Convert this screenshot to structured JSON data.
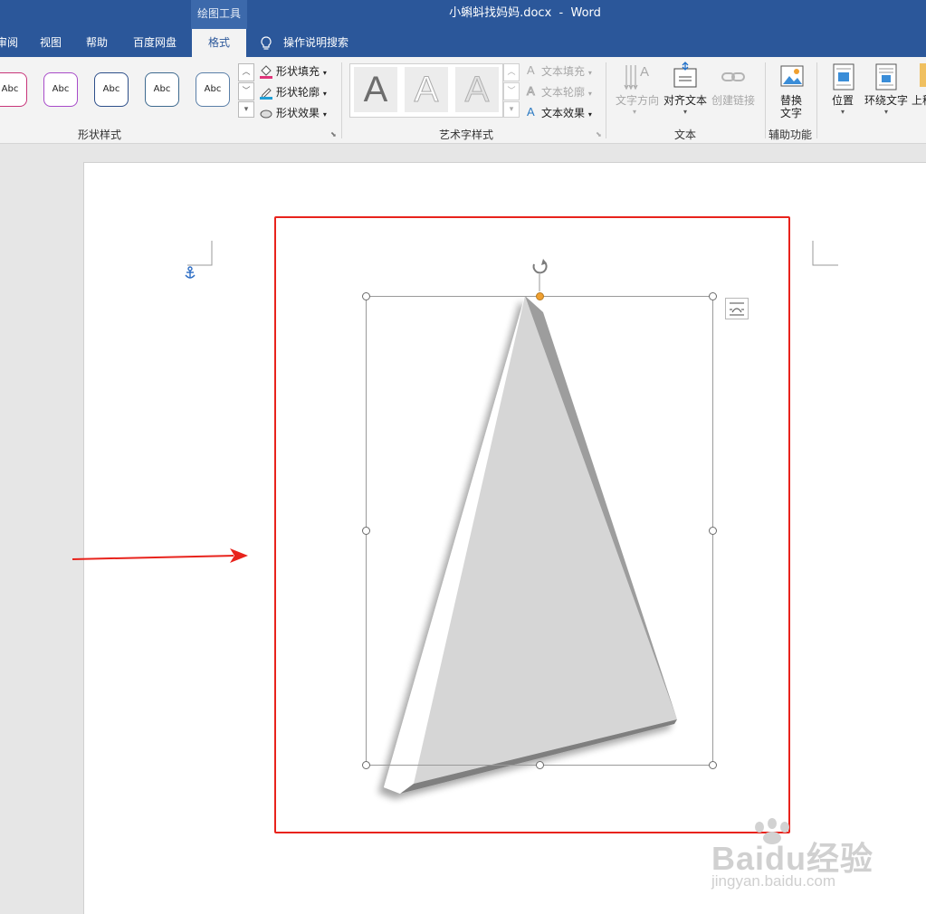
{
  "window": {
    "title": "小蝌蚪找妈妈.docx  -  Word",
    "context_tab": "绘图工具"
  },
  "tabs": [
    {
      "label": "审阅"
    },
    {
      "label": "视图"
    },
    {
      "label": "帮助"
    },
    {
      "label": "百度网盘"
    },
    {
      "label": "格式",
      "active": true
    }
  ],
  "tell_me": {
    "label": "操作说明搜索"
  },
  "ribbon": {
    "shape_styles": {
      "label": "形状样式",
      "gallery": [
        "Abc",
        "Abc",
        "Abc",
        "Abc",
        "Abc"
      ],
      "gallery_colors": [
        "#c8357a",
        "#a84bc9",
        "#2d4f8a",
        "#3e6a8f",
        "#5a7fa8"
      ],
      "fill": "形状填充",
      "outline": "形状轮廓",
      "effects": "形状效果"
    },
    "wordart": {
      "label": "艺术字样式",
      "samples": [
        "A",
        "A",
        "A"
      ],
      "text_fill": "文本填充",
      "text_outline": "文本轮廓",
      "text_effects": "文本效果"
    },
    "text": {
      "label": "文本",
      "direction": "文字方向",
      "align": "对齐文本",
      "link": "创建链接"
    },
    "accessibility": {
      "label": "辅助功能",
      "alt_text_line1": "替换",
      "alt_text_line2": "文字"
    },
    "arrange": {
      "position": "位置",
      "wrap": "环绕文字",
      "forward": "上移"
    }
  },
  "document": {
    "shape": "triangle-with-3d-bevel",
    "highlight_color": "#e8231c",
    "arrow_color": "#e8231c"
  },
  "watermark": {
    "brand": "Baidu经验",
    "url": "jingyan.baidu.com"
  },
  "colors": {
    "accent": "#2b579a",
    "ribbon_bg": "#f3f3f3",
    "handle_rotation": "#f0a030"
  }
}
